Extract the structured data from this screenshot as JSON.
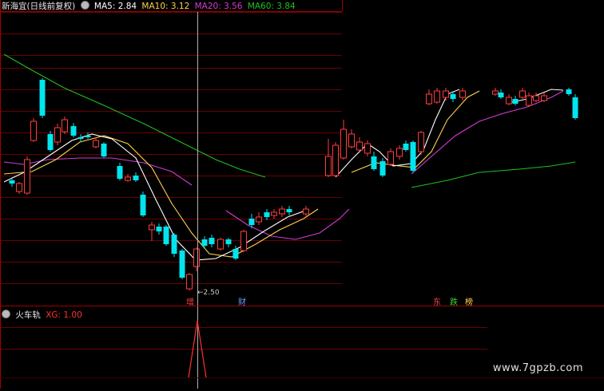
{
  "header": {
    "title": "新海宜(日线前复权)",
    "ma": [
      {
        "label": "MA5: 2.84",
        "color": "#ffffff"
      },
      {
        "label": "MA10: 3.12",
        "color": "#ffd24a"
      },
      {
        "label": "MA20: 3.56",
        "color": "#d23cd2"
      },
      {
        "label": "MA60: 3.84",
        "color": "#1fbf1f"
      }
    ]
  },
  "price_low_label": "←2.50",
  "event_markers": [
    {
      "text": "增",
      "color": "#ff4040"
    },
    {
      "text": "财",
      "color": "#6f9cff"
    },
    {
      "text": "东",
      "color": "#ff4040"
    },
    {
      "text": "跌",
      "color": "#39d439"
    },
    {
      "text": "榜",
      "color": "#ffd24a"
    }
  ],
  "indicator": {
    "name": "火车轨",
    "value_label": "XG: 1.00",
    "value_color": "#ff3030"
  },
  "watermark": "www.7gpzb.com",
  "colors": {
    "up": "#ff3c3c",
    "down": "#00e5ee",
    "grid": "#6a0000",
    "border": "#a00000",
    "cursor": "#b0b0b0"
  }
}
